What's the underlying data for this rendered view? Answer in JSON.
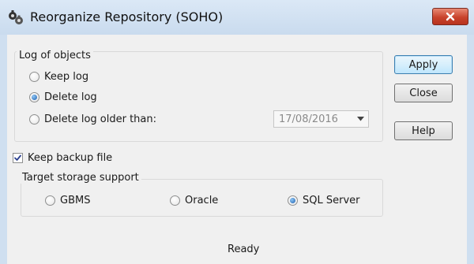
{
  "window": {
    "title": "Reorganize Repository (SOHO)",
    "close_icon": "close-icon",
    "app_icon": "repository-app-icon"
  },
  "log_group": {
    "label": "Log of objects",
    "options": [
      {
        "label": "Keep log",
        "checked": false
      },
      {
        "label": "Delete log",
        "checked": true
      },
      {
        "label": "Delete log older than:",
        "checked": false
      }
    ],
    "date_value": "17/08/2016"
  },
  "keep_backup": {
    "label": "Keep backup file",
    "checked": true
  },
  "storage_group": {
    "label": "Target storage support",
    "options": [
      {
        "label": "GBMS",
        "checked": false
      },
      {
        "label": "Oracle",
        "checked": false
      },
      {
        "label": "SQL Server",
        "checked": true
      }
    ]
  },
  "buttons": {
    "apply": "Apply",
    "close": "Close",
    "help": "Help"
  },
  "status": "Ready",
  "colors": {
    "titlebar": "#c9dbee",
    "close_button": "#c9432c",
    "client_bg": "#f0f0f0",
    "radio_selected": "#1d5fb0"
  }
}
